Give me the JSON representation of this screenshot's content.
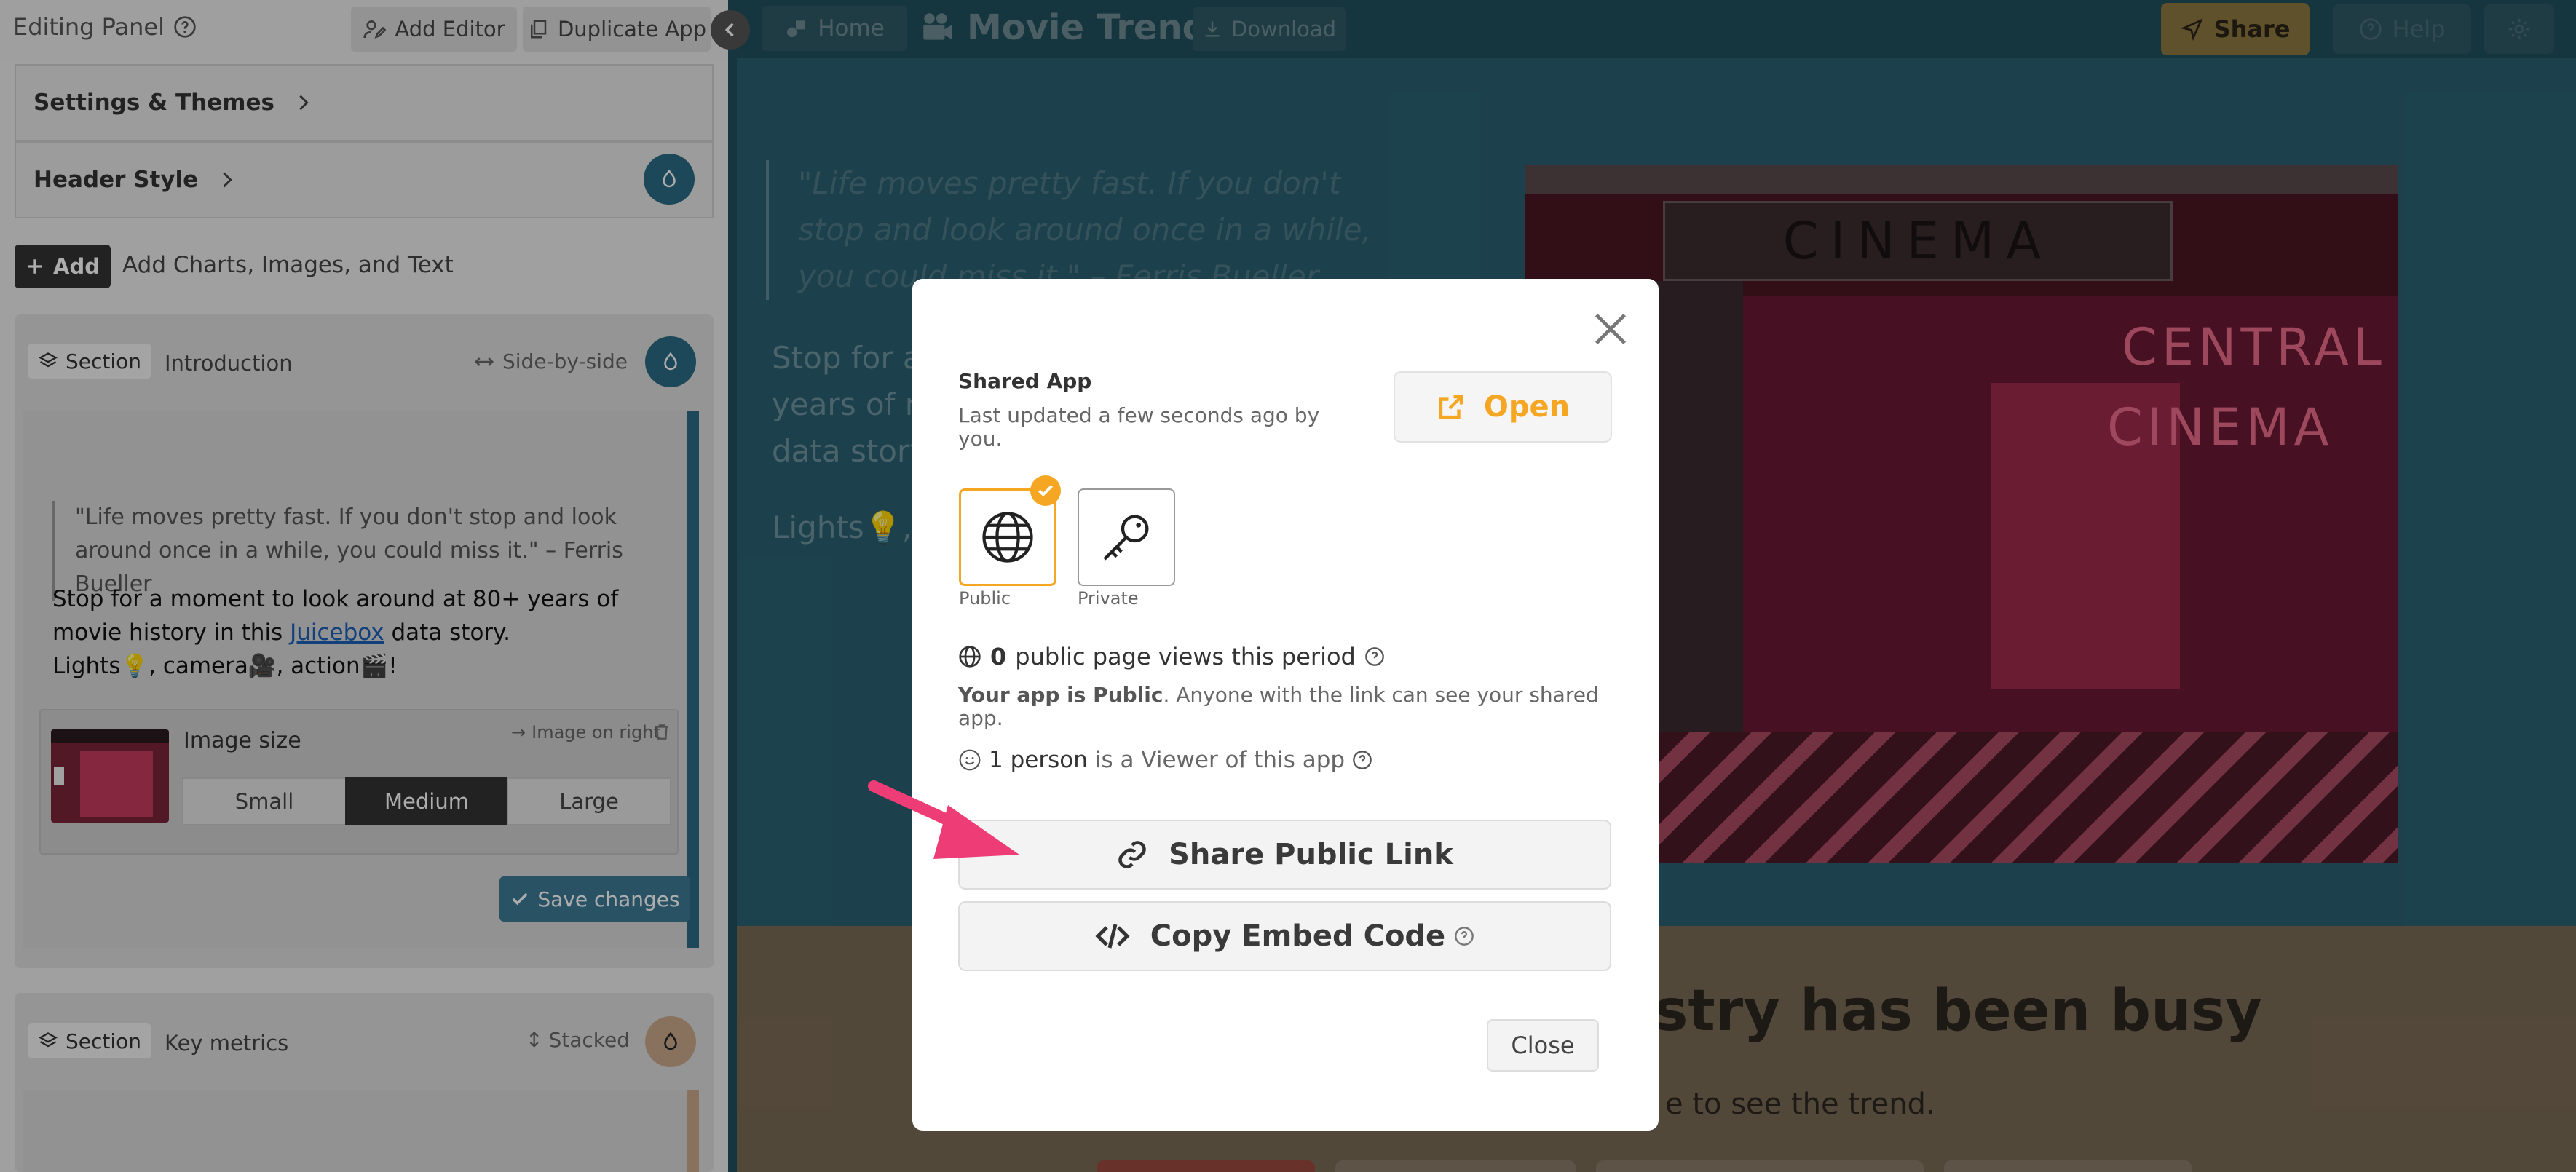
{
  "left_panel": {
    "title": "Editing Panel",
    "add_editor": "Add Editor",
    "duplicate_app": "Duplicate App",
    "accordion": [
      "Settings & Themes",
      "Header Style"
    ],
    "add_button": "Add",
    "add_caption": "Add Charts, Images, and Text",
    "sections": [
      {
        "tag": "Section",
        "name": "Introduction",
        "layout": "Side-by-side"
      },
      {
        "tag": "Section",
        "name": "Key metrics",
        "layout": "Stacked"
      }
    ],
    "intro": {
      "quote": "\"Life moves pretty fast. If you don't stop and look around once in a while, you could miss it.\" – Ferris Bueller",
      "para1_before": "Stop for a moment to look around at 80+ years of movie history in this ",
      "para1_link": "Juicebox",
      "para1_after": " data story.",
      "para2": "Lights💡, camera🎥, action🎬!"
    },
    "image_size": {
      "label": "Image size",
      "position": "Image on right",
      "options": [
        "Small",
        "Medium",
        "Large"
      ],
      "selected": "Medium"
    },
    "save_changes": "Save changes"
  },
  "topbar": {
    "home": "Home",
    "title": "Movie Trends",
    "download": "Download",
    "share": "Share",
    "help": "Help"
  },
  "story": {
    "quote_lines": [
      "\"Life moves pretty fast. If you don't",
      "stop and look around once in a while,",
      "you could miss it.\" – Ferris Bueller"
    ],
    "body_lines": [
      "Stop for a",
      "years of m",
      "data story."
    ],
    "lights": "Lights💡, c",
    "cinema_sign": "CINEMA",
    "neon_top": "CENTRAL",
    "neon_bottom": "CINEMA",
    "heading_fragment": "stry has been busy",
    "sub_fragment": "e to see the trend."
  },
  "modal": {
    "title": "Shared App",
    "updated": "Last updated a few seconds ago by you.",
    "open": "Open",
    "public_label": "Public",
    "private_label": "Private",
    "views_count": "0",
    "views_text": "public page views this period",
    "app_public_bold": "Your app is Public",
    "app_public_rest": ". Anyone with the link can see your shared app.",
    "viewers_count": "1 person",
    "viewers_text": "is a Viewer of this app",
    "share_link": "Share Public Link",
    "copy_embed": "Copy Embed Code",
    "close": "Close"
  },
  "colors": {
    "accent": "#f5a623",
    "teal": "#2a6172",
    "arrow": "#ee3d76"
  }
}
